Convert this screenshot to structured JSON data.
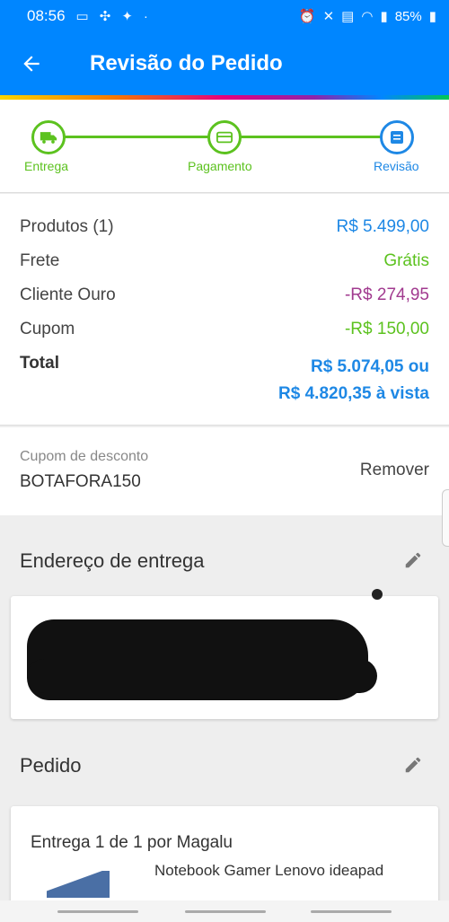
{
  "status": {
    "time": "08:56",
    "battery": "85%"
  },
  "appbar": {
    "title": "Revisão do Pedido"
  },
  "steps": [
    {
      "label": "Entrega"
    },
    {
      "label": "Pagamento"
    },
    {
      "label": "Revisão"
    }
  ],
  "summary": {
    "products_label": "Produtos (1)",
    "products_value": "R$ 5.499,00",
    "shipping_label": "Frete",
    "shipping_value": "Grátis",
    "gold_label": "Cliente Ouro",
    "gold_value": "-R$ 274,95",
    "coupon_label": "Cupom",
    "coupon_value": "-R$ 150,00",
    "total_label": "Total",
    "total_value": "R$ 5.074,05 ou",
    "total_cash": "R$ 4.820,35 à vista"
  },
  "coupon": {
    "caption": "Cupom de desconto",
    "code": "BOTAFORA150",
    "remove": "Remover"
  },
  "address": {
    "title": "Endereço de entrega"
  },
  "order": {
    "title": "Pedido",
    "delivery": "Entrega 1 de 1 por Magalu",
    "product": "Notebook Gamer Lenovo ideapad"
  },
  "colors": {
    "primary": "#0086ff",
    "accent_blue": "#1e88e5",
    "green": "#5cc21f",
    "purple": "#a13a8f"
  }
}
